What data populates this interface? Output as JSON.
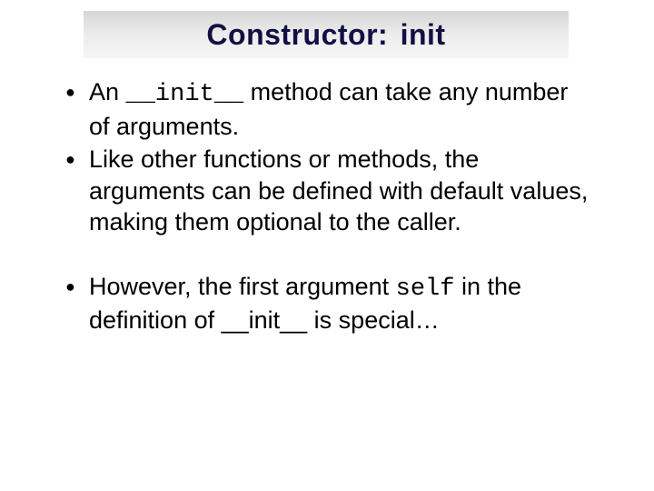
{
  "title": {
    "prefix": "Constructor:",
    "under1": "  ",
    "mid": "init",
    "under2": "  "
  },
  "bullets": {
    "b1": {
      "t1": "An ",
      "code": "__init__",
      "t2": " method can take any number of arguments."
    },
    "b2": {
      "text": "Like other functions or methods, the arguments can be defined with default values, making them optional to the caller."
    },
    "b3": {
      "t1": "However, the first argument ",
      "code": "self",
      "t2": " in the definition of __init__ is special…"
    }
  }
}
